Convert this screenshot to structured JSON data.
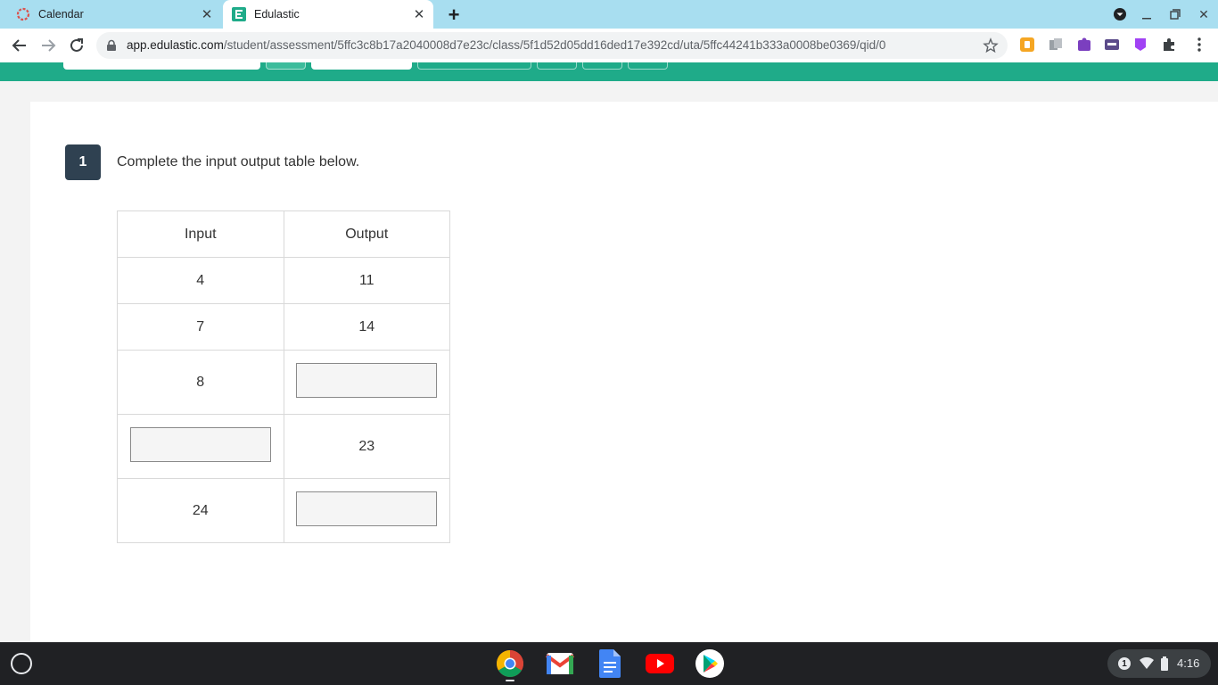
{
  "browser": {
    "tabs": [
      {
        "title": "Calendar",
        "icon": "calendar-favicon",
        "active": false
      },
      {
        "title": "Edulastic",
        "icon": "edulastic-favicon",
        "active": true
      }
    ],
    "url_host": "app.edulastic.com",
    "url_path": "/student/assessment/5ffc3c8b17a2040008d7e23c/class/5f1d52d05dd16ded17e392cd/uta/5ffc44241b333a0008be0369/qid/0"
  },
  "question": {
    "number": "1",
    "prompt": "Complete the input output table below.",
    "table": {
      "headers": [
        "Input",
        "Output"
      ],
      "rows": [
        {
          "input": "4",
          "output": "11"
        },
        {
          "input": "7",
          "output": "14"
        },
        {
          "input": "8",
          "output": ""
        },
        {
          "input": "",
          "output": "23"
        },
        {
          "input": "24",
          "output": ""
        }
      ]
    }
  },
  "taskbar": {
    "apps": [
      "chrome-icon",
      "gmail-icon",
      "docs-icon",
      "youtube-icon",
      "play-store-icon"
    ],
    "notification_count": "1",
    "clock": "4:16"
  },
  "colors": {
    "teal_accent": "#1fab89",
    "question_badge": "#2f4151",
    "tab_strip": "#a8def0"
  }
}
